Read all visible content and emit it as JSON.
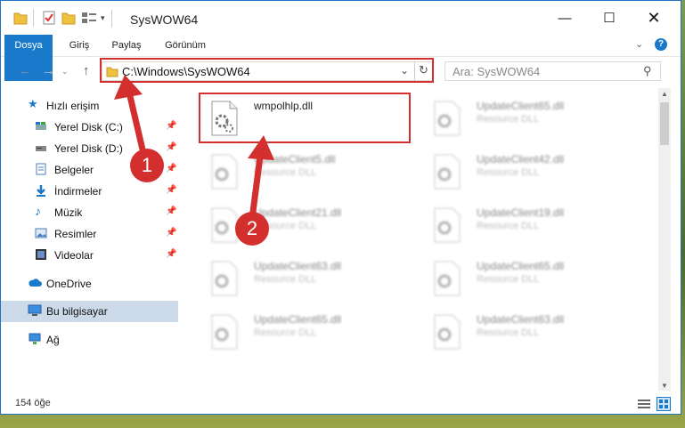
{
  "window": {
    "title": "SysWOW64"
  },
  "ribbon": {
    "tabs": [
      "Dosya",
      "Giriş",
      "Paylaş",
      "Görünüm"
    ]
  },
  "address": {
    "path": "C:\\Windows\\SysWOW64"
  },
  "search": {
    "placeholder": "Ara: SysWOW64"
  },
  "sidebar": {
    "quick_access": "Hızlı erişim",
    "items": [
      "Yerel Disk (C:)",
      "Yerel Disk (D:)",
      "Belgeler",
      "İndirmeler",
      "Müzik",
      "Resimler",
      "Videolar"
    ],
    "onedrive": "OneDrive",
    "this_pc": "Bu bilgisayar",
    "network": "Ağ"
  },
  "files": [
    {
      "name": "wmpolhlp.dll",
      "type": ""
    },
    {
      "name": "UpdateClient65.dll",
      "type": "Resource DLL"
    },
    {
      "name": "UpdateClient5.dll",
      "type": "Resource DLL"
    },
    {
      "name": "UpdateClient42.dll",
      "type": "Resource DLL"
    },
    {
      "name": "UpdateClient21.dll",
      "type": "Resource DLL"
    },
    {
      "name": "UpdateClient19.dll",
      "type": "Resource DLL"
    },
    {
      "name": "UpdateClient63.dll",
      "type": "Resource DLL"
    },
    {
      "name": "UpdateClient65.dll",
      "type": "Resource DLL"
    },
    {
      "name": "UpdateClient65.dll",
      "type": "Resource DLL"
    },
    {
      "name": "UpdateClient63.dll",
      "type": "Resource DLL"
    }
  ],
  "status": {
    "count": "154 öğe"
  },
  "annotations": {
    "step1": "1",
    "step2": "2"
  },
  "colors": {
    "accent": "#1979ca",
    "annotation": "#d32f2f"
  }
}
